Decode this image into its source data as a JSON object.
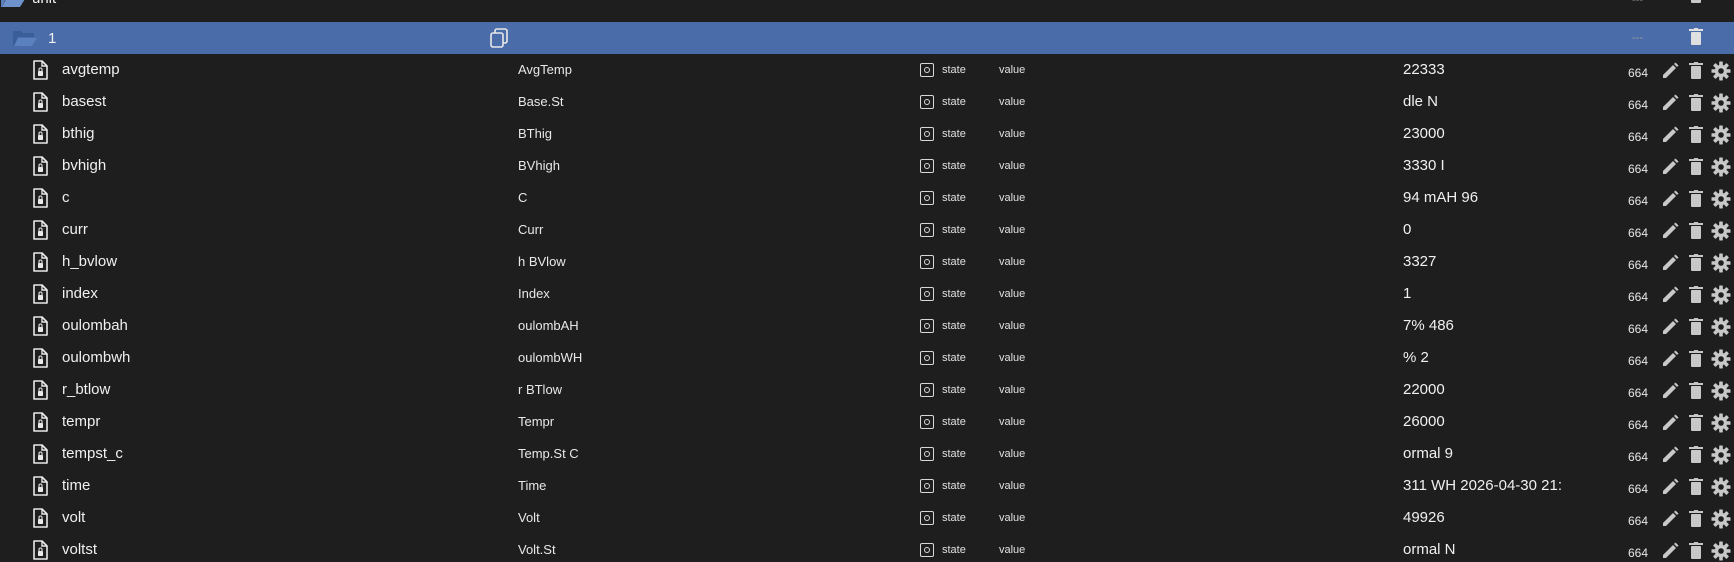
{
  "folder": {
    "name": "unit",
    "dash": "---"
  },
  "selected": {
    "name": "1",
    "dash": "---"
  },
  "columns": {
    "role_label": "state",
    "kind_label": "value"
  },
  "rows": [
    {
      "id": "avgtemp",
      "name": "AvgTemp",
      "value": "22333",
      "acl": "664"
    },
    {
      "id": "basest",
      "name": "Base.St",
      "value": "dle N",
      "acl": "664"
    },
    {
      "id": "bthig",
      "name": "BThig",
      "value": "23000",
      "acl": "664"
    },
    {
      "id": "bvhigh",
      "name": "BVhigh",
      "value": "3330 I",
      "acl": "664"
    },
    {
      "id": "c",
      "name": "C",
      "value": "94 mAH 96",
      "acl": "664"
    },
    {
      "id": "curr",
      "name": "Curr",
      "value": "0",
      "acl": "664"
    },
    {
      "id": "h_bvlow",
      "name": "h BVlow",
      "value": "3327",
      "acl": "664"
    },
    {
      "id": "index",
      "name": "Index",
      "value": "1",
      "acl": "664"
    },
    {
      "id": "oulombah",
      "name": "oulombAH",
      "value": "7% 486",
      "acl": "664"
    },
    {
      "id": "oulombwh",
      "name": "oulombWH",
      "value": "% 2",
      "acl": "664"
    },
    {
      "id": "r_btlow",
      "name": "r BTlow",
      "value": "22000",
      "acl": "664"
    },
    {
      "id": "tempr",
      "name": "Tempr",
      "value": "26000",
      "acl": "664"
    },
    {
      "id": "tempst_c",
      "name": "Temp.St C",
      "value": "ormal 9",
      "acl": "664"
    },
    {
      "id": "time",
      "name": "Time",
      "value": "311 WH 2026-04-30 21:",
      "acl": "664"
    },
    {
      "id": "volt",
      "name": "Volt",
      "value": "49926",
      "acl": "664"
    },
    {
      "id": "voltst",
      "name": "Volt.St",
      "value": "ormal N",
      "acl": "664"
    }
  ],
  "colors": {
    "background": "#1e1e1e",
    "selected_row": "#4a6ca8",
    "icon": "#c8c8c8"
  }
}
